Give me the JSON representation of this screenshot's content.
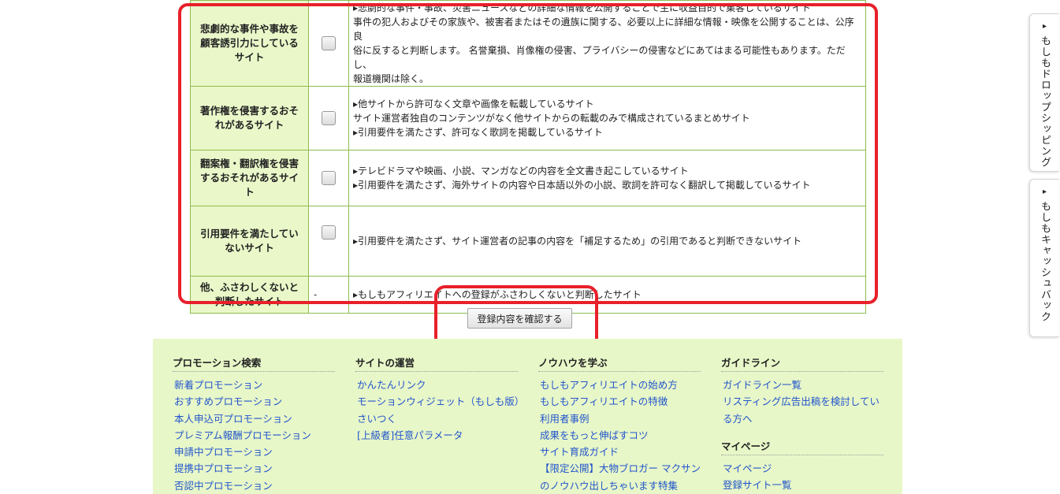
{
  "rules": [
    {
      "category": "悲劇的な事件や事故を顧客誘引力にしているサイト",
      "has_checkbox": true,
      "lines": [
        "▸悲劇的な事件・事故、災害ニュースなどの詳細な情報を公開することで主に収益目的で集客しているサイト",
        "事件の犯人およびその家族や、被害者またはその遺族に関する、必要以上に詳細な情報・映像を公開することは、公序良",
        "俗に反すると判断します。 名誉棄損、肖像権の侵害、プライバシーの侵害などにあてはまる可能性もあります。ただし、",
        "報道機関は除く。"
      ]
    },
    {
      "category": "著作権を侵害するおそれがあるサイト",
      "has_checkbox": true,
      "lines": [
        "▸他サイトから許可なく文章や画像を転載しているサイト",
        "サイト運営者独自のコンテンツがなく他サイトからの転載のみで構成されているまとめサイト",
        "▸引用要件を満たさず、許可なく歌詞を掲載しているサイト"
      ]
    },
    {
      "category": "翻案権・翻訳権を侵害するおそれがあるサイト",
      "has_checkbox": true,
      "lines": [
        "▸テレビドラマや映画、小説、マンガなどの内容を全文書き起こしているサイト",
        "▸引用要件を満たさず、海外サイトの内容や日本語以外の小説、歌詞を許可なく翻訳して掲載しているサイト"
      ]
    },
    {
      "category": "引用要件を満たしていないサイト",
      "has_checkbox": true,
      "lines": [
        "▸引用要件を満たさず、サイト運営者の記事の内容を「補足するため」の引用であると判断できないサイト"
      ]
    },
    {
      "category": "他、ふさわしくないと判断したサイト",
      "has_checkbox": false,
      "check_text": "-",
      "lines": [
        "▸もしもアフィリエイトへの登録がふさわしくないと判断したサイト"
      ]
    }
  ],
  "confirm_button": "登録内容を確認する",
  "footer": {
    "columns": [
      {
        "title": "プロモーション検索",
        "links": [
          "新着プロモーション",
          "おすすめプロモーション",
          "本人申込可プロモーション",
          "プレミアム報酬プロモーション",
          "申請中プロモーション",
          "提携中プロモーション",
          "否認中プロモーション"
        ]
      },
      {
        "title": "サイトの運営",
        "links": [
          "かんたんリンク",
          "モーションウィジェット（もしも版）",
          "さいつく",
          "[上級者]任意パラメータ"
        ]
      },
      {
        "title": "ノウハウを学ぶ",
        "links": [
          "もしもアフィリエイトの始め方",
          "もしもアフィリエイトの特徴",
          "利用者事例",
          "成果をもっと伸ばすコツ",
          "サイト育成ガイド",
          "【限定公開】大物ブロガー マクサン",
          "のノウハウ出しちゃいます特集"
        ]
      },
      {
        "title": "ガイドライン",
        "links": [
          "ガイドライン一覧",
          "リスティング広告出稿を検討している方へ"
        ]
      }
    ],
    "mypage": {
      "title": "マイページ",
      "links": [
        "マイページ",
        "登録サイト一覧"
      ]
    }
  },
  "side_tabs": [
    {
      "arrow": "▸",
      "label": "もしもドロップシッピング"
    },
    {
      "arrow": "▸",
      "label": "もしもキャッシュバック"
    }
  ],
  "colors": {
    "category_bg": "#eaf8c9",
    "table_border": "#8dbb4f",
    "footer_bg": "#e8f7c8",
    "link": "#2255cc",
    "highlight": "#e8202a"
  }
}
